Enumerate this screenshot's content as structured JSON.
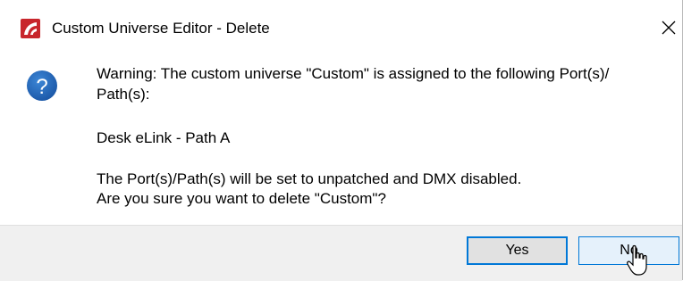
{
  "window": {
    "title": "Custom Universe Editor - Delete",
    "app_icon": "app-logo-icon",
    "close_symbol": "✕"
  },
  "message": {
    "icon": "question-icon",
    "icon_glyph": "?",
    "line1": "Warning:  The custom universe \"Custom\" is assigned to the following Port(s)/",
    "line2": "Path(s):",
    "line3": "Desk eLink - Path A",
    "line4": "The Port(s)/Path(s) will be set to unpatched and DMX disabled.",
    "line5": "Are you sure you want to delete \"Custom\"?"
  },
  "buttons": {
    "yes_label": "Yes",
    "no_label": "No"
  },
  "colors": {
    "accent": "#0078d7",
    "question_icon_bg": "#1d5fb4",
    "app_icon_red": "#c8262c",
    "footer_bg": "#f0f0f0"
  }
}
